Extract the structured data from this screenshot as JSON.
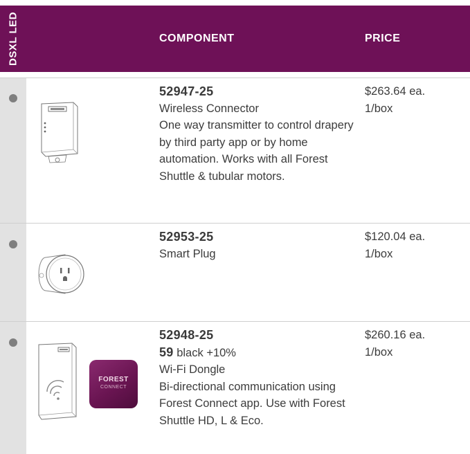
{
  "header": {
    "side_label": "DSXL LED",
    "component_label": "COMPONENT",
    "price_label": "PRICE"
  },
  "rows": [
    {
      "part_number": "52947-25",
      "name": "Wireless Connector",
      "description": "One way transmitter to control drapery by third party app or by home automation. Works with all Forest Shuttle & tubular motors.",
      "price": "$263.64 ea.",
      "pack": "1/box",
      "image": "wireless-connector-illustration"
    },
    {
      "part_number": "52953-25",
      "name": "Smart Plug",
      "description": "",
      "price": "$120.04 ea.",
      "pack": "1/box",
      "image": "smart-plug-illustration"
    },
    {
      "part_number": "52948-25",
      "color_code": "59",
      "color_note": "black +10%",
      "name": "Wi-Fi Dongle",
      "description": "Bi-directional communication using Forest Connect app. Use with Forest Shuttle HD, L & Eco.",
      "price": "$260.16 ea.",
      "pack": "1/box",
      "image": "wifi-dongle-illustration",
      "app_icon_text_line1": "FOREST",
      "app_icon_text_line2": "CONNECT"
    }
  ],
  "colors": {
    "header_bg": "#6e1157",
    "sidebar_bg": "#e2e2e2",
    "dot": "#7f7f7f",
    "app_icon": "#6a1552"
  }
}
